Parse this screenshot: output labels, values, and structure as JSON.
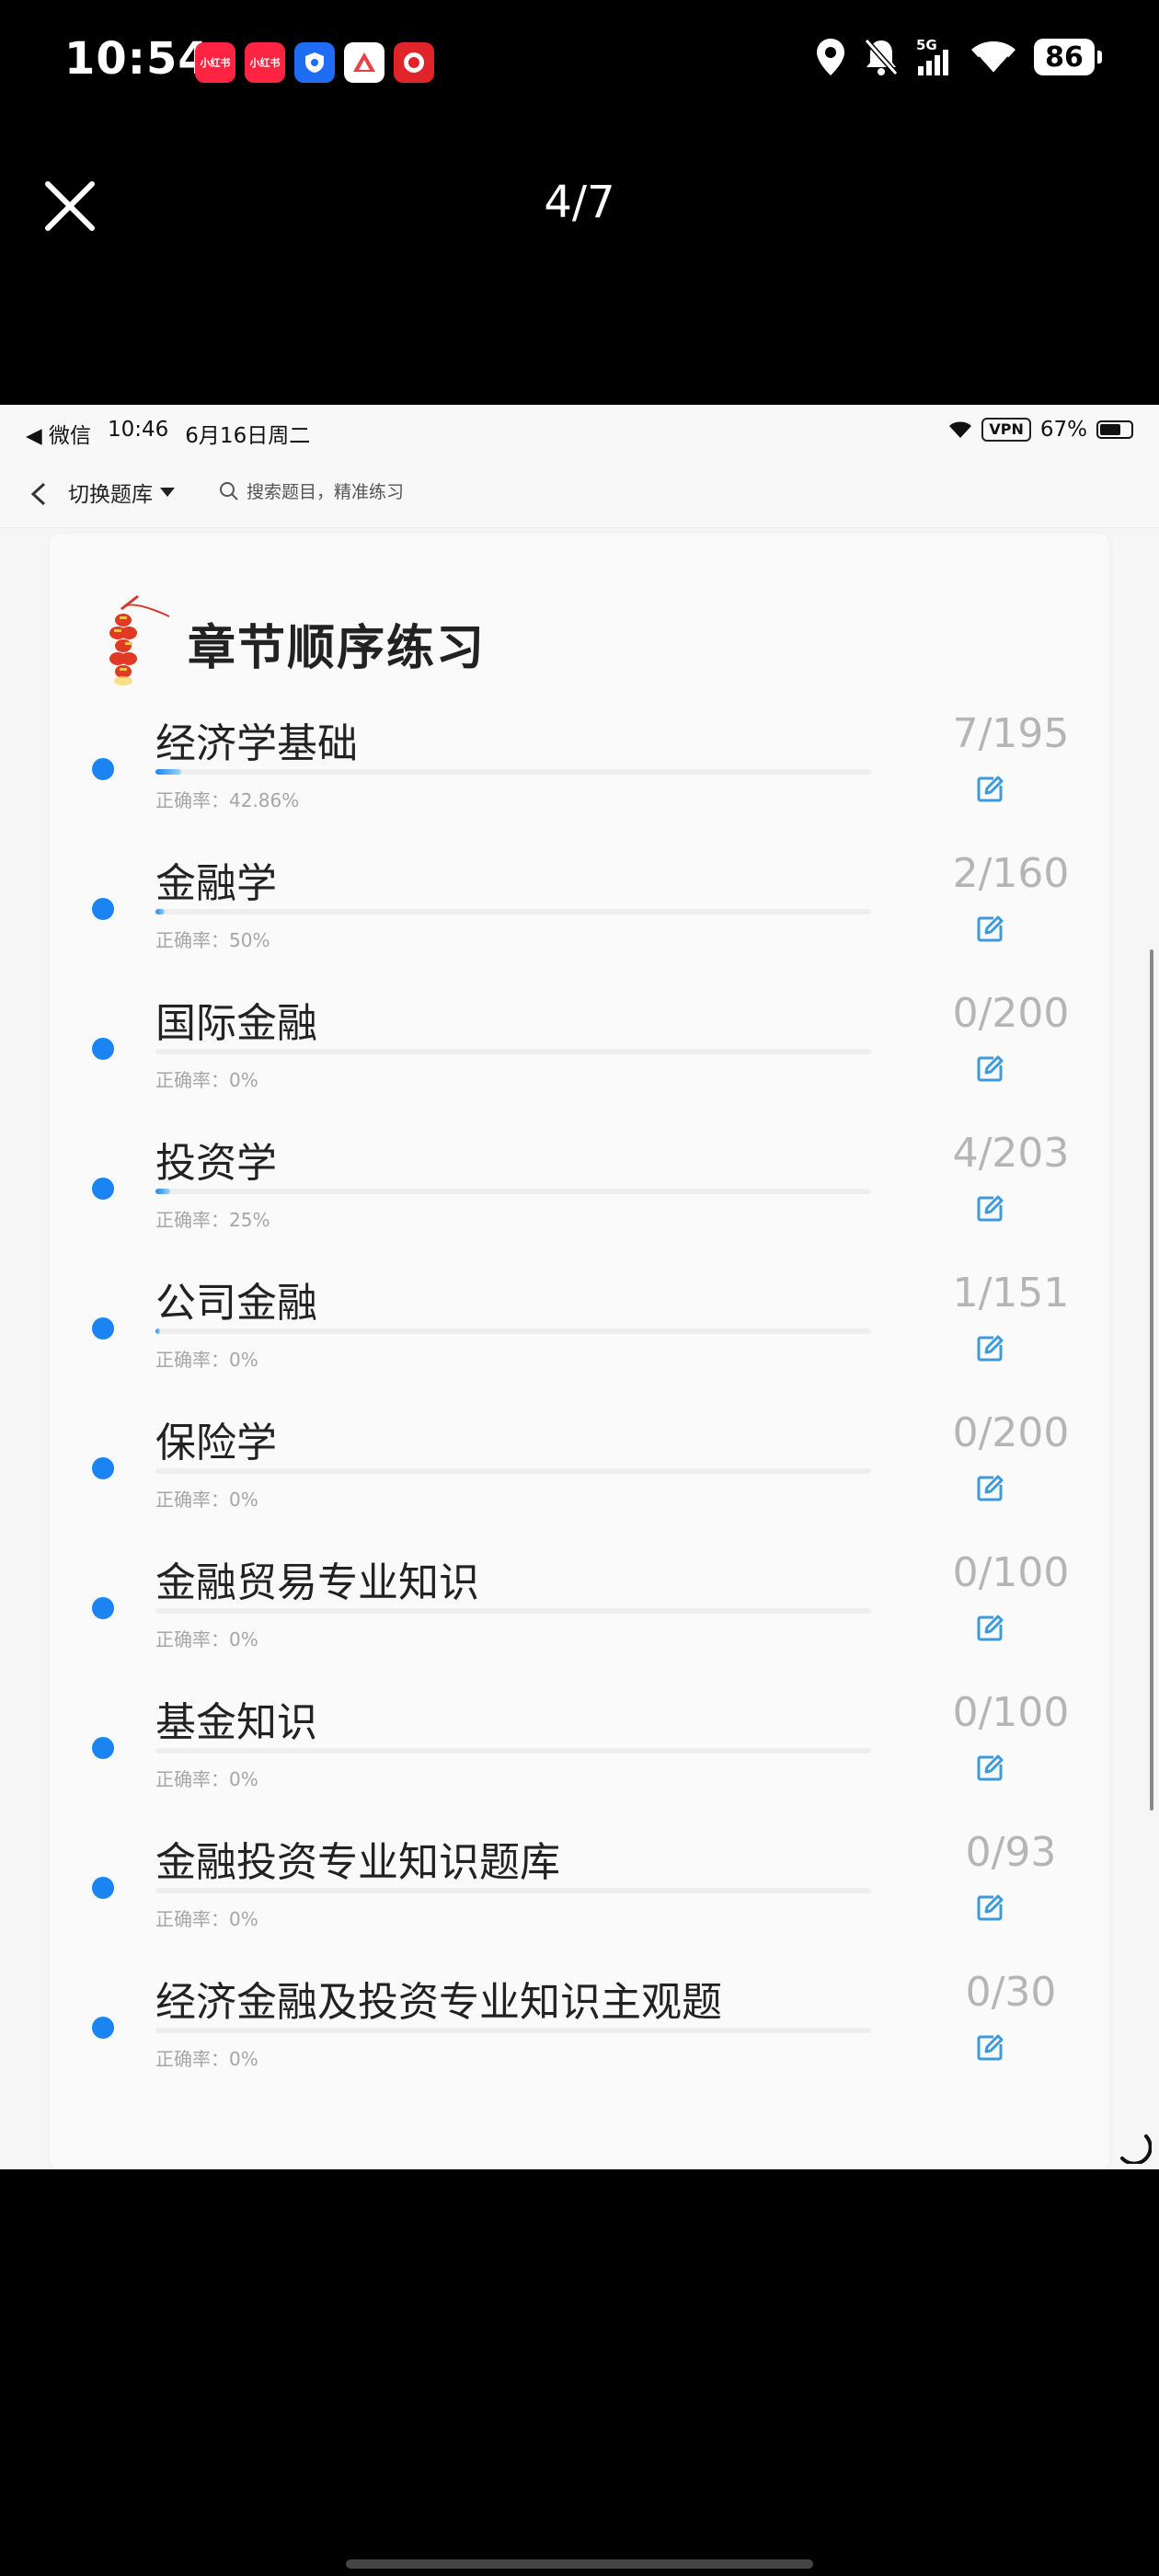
{
  "phone_status": {
    "time": "10:54",
    "app_icons": [
      {
        "name": "xiaohongshu-icon",
        "label": "小红书",
        "color": "#ff2442"
      },
      {
        "name": "xiaohongshu-icon-2",
        "label": "小红书",
        "color": "#ff2442"
      },
      {
        "name": "shield-app-icon",
        "label": "",
        "color": "#1f6df5"
      },
      {
        "name": "triangle-app-icon",
        "label": "",
        "color": "#ffffff"
      },
      {
        "name": "pinduoduo-icon",
        "label": "",
        "color": "#e0242a"
      }
    ],
    "battery": "86"
  },
  "viewer": {
    "counter": "4/7"
  },
  "inner_status": {
    "back_app": "◀ 微信",
    "time": "10:46",
    "date": "6月16日周二",
    "vpn": "VPN",
    "battery": "67%"
  },
  "inner_nav": {
    "switch_label": "切换题库",
    "search_placeholder": "搜索题目，精准练习"
  },
  "section": {
    "title": "章节顺序练习"
  },
  "chapters": [
    {
      "name": "经济学基础",
      "accuracy": "正确率：42.86%",
      "count": "7/195",
      "progress": 0.036
    },
    {
      "name": "金融学",
      "accuracy": "正确率：50%",
      "count": "2/160",
      "progress": 0.0125
    },
    {
      "name": "国际金融",
      "accuracy": "正确率：0%",
      "count": "0/200",
      "progress": 0
    },
    {
      "name": "投资学",
      "accuracy": "正确率：25%",
      "count": "4/203",
      "progress": 0.02
    },
    {
      "name": "公司金融",
      "accuracy": "正确率：0%",
      "count": "1/151",
      "progress": 0.0066
    },
    {
      "name": "保险学",
      "accuracy": "正确率：0%",
      "count": "0/200",
      "progress": 0
    },
    {
      "name": "金融贸易专业知识",
      "accuracy": "正确率：0%",
      "count": "0/100",
      "progress": 0
    },
    {
      "name": "基金知识",
      "accuracy": "正确率：0%",
      "count": "0/100",
      "progress": 0
    },
    {
      "name": "金融投资专业知识题库",
      "accuracy": "正确率：0%",
      "count": "0/93",
      "progress": 0
    },
    {
      "name": "经济金融及投资专业知识主观题",
      "accuracy": "正确率：0%",
      "count": "0/30",
      "progress": 0
    }
  ],
  "colors": {
    "accent": "#1a84f2",
    "edit_icon": "#3a9be0",
    "count": "#b5b5b5"
  }
}
